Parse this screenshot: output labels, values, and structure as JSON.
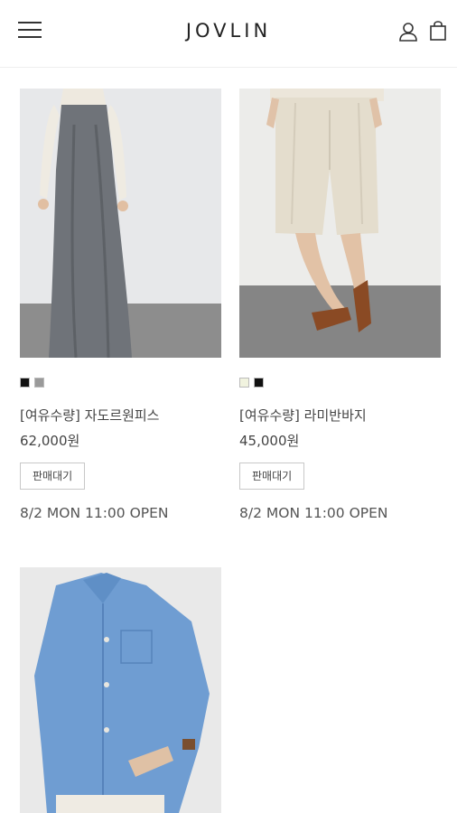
{
  "header": {
    "logo": "JOVLIN",
    "icons": [
      "menu-icon",
      "user-icon",
      "shopping-bag-icon"
    ]
  },
  "products": [
    {
      "name": "[여유수량] 자도르원피스",
      "price": "62,000원",
      "status": "판매대기",
      "open_date": "8/2 MON 11:00 OPEN",
      "swatches": [
        "#111111",
        "#9a9a9a"
      ]
    },
    {
      "name": "[여유수량] 라미반바지",
      "price": "45,000원",
      "status": "판매대기",
      "open_date": "8/2 MON 11:00 OPEN",
      "swatches": [
        "#f1f3df",
        "#111111"
      ]
    },
    {
      "name": "",
      "price": "",
      "status": "",
      "open_date": "",
      "swatches": []
    }
  ]
}
